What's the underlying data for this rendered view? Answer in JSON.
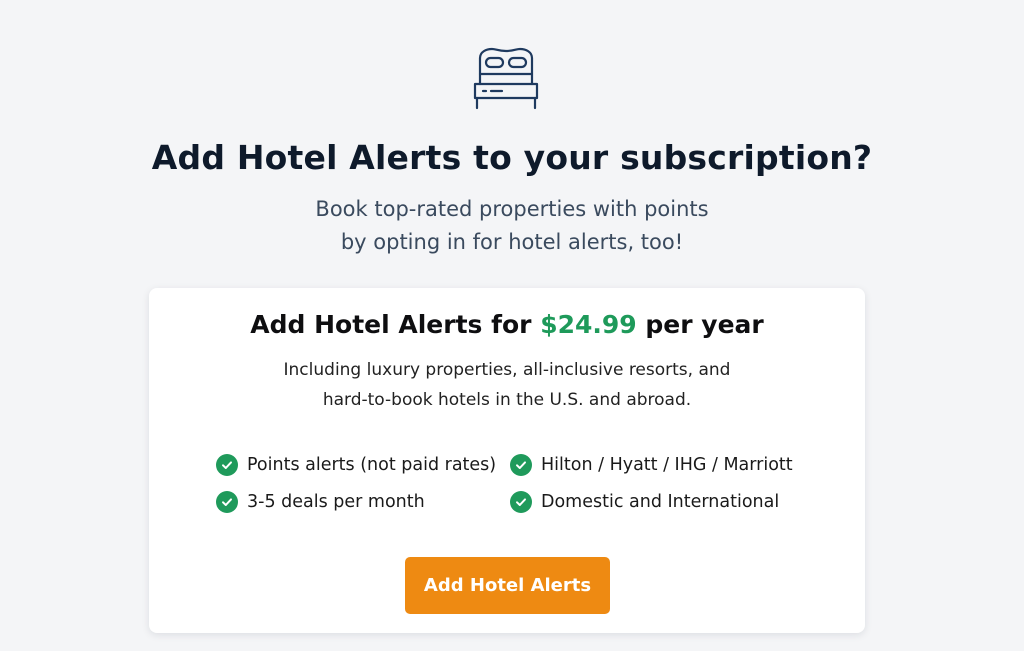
{
  "icon": {
    "name": "bed-icon",
    "color": "#1f3a5f"
  },
  "header": {
    "title": "Add Hotel Alerts to your subscription?",
    "subtitle_line1": "Book top-rated properties with points",
    "subtitle_line2": "by opting in for hotel alerts, too!"
  },
  "card": {
    "title_prefix": "Add Hotel Alerts for ",
    "price": "$24.99",
    "title_suffix": " per year",
    "desc_line1": "Including luxury properties, all-inclusive resorts, and",
    "desc_line2": "hard-to-book hotels in the U.S. and abroad.",
    "features": [
      {
        "icon": "check-circle-icon",
        "label": "Points alerts (not paid rates)"
      },
      {
        "icon": "check-circle-icon",
        "label": "Hilton / Hyatt / IHG / Marriott"
      },
      {
        "icon": "check-circle-icon",
        "label": "3-5 deals per month"
      },
      {
        "icon": "check-circle-icon",
        "label": "Domestic and International"
      }
    ],
    "cta_label": "Add Hotel Alerts"
  },
  "colors": {
    "accent_green": "#1e9a5a",
    "cta_orange": "#ee8a12",
    "heading": "#0e1a2b",
    "background": "#f4f5f7"
  }
}
